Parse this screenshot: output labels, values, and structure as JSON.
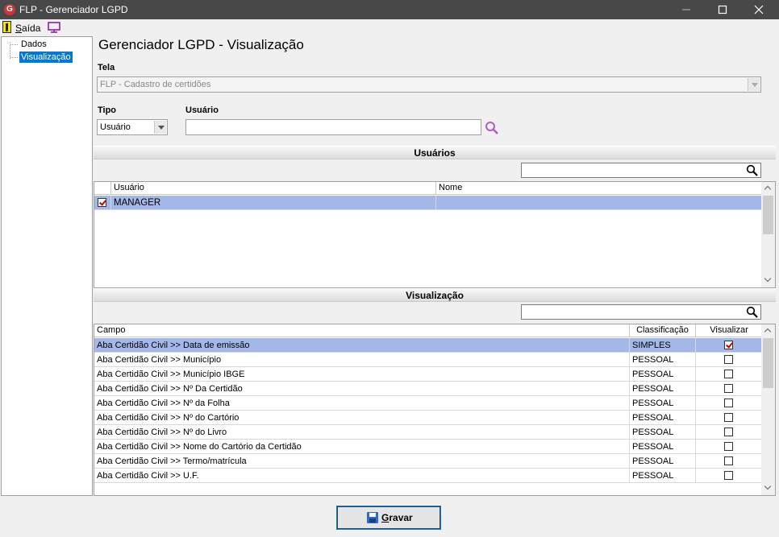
{
  "window": {
    "title": "FLP - Gerenciador LGPD",
    "app_icon_letter": "G",
    "minimize_glyph": "—",
    "maximize_glyph": "□",
    "close_glyph": "✕"
  },
  "menu": {
    "exit_label_first": "S",
    "exit_label_rest": "aída",
    "exit_icon": "exit-door-icon",
    "monitor_icon": "monitor-icon"
  },
  "tree": {
    "items": [
      {
        "label": "Dados",
        "selected": false
      },
      {
        "label": "Visualização",
        "selected": true
      }
    ]
  },
  "form": {
    "page_title": "Gerenciador LGPD - Visualização",
    "screen_label": "Tela",
    "screen_value": "FLP - Cadastro de certidões",
    "type_label": "Tipo",
    "type_value": "Usuário",
    "user_label": "Usuário",
    "user_value": ""
  },
  "users_section": {
    "title": "Usuários",
    "search_value": "",
    "columns": [
      "Usuário",
      "Nome"
    ],
    "rows": [
      {
        "checked": true,
        "usuario": "MANAGER",
        "nome": ""
      }
    ]
  },
  "view_section": {
    "title": "Visualização",
    "search_value": "",
    "columns": [
      "Campo",
      "Classificação",
      "Visualizar"
    ],
    "rows": [
      {
        "campo": "Aba Certidão Civil >> Data de emissão",
        "classificacao": "SIMPLES",
        "visualizar": true
      },
      {
        "campo": "Aba Certidão Civil >> Município",
        "classificacao": "PESSOAL",
        "visualizar": false
      },
      {
        "campo": "Aba Certidão Civil >> Município IBGE",
        "classificacao": "PESSOAL",
        "visualizar": false
      },
      {
        "campo": "Aba Certidão Civil >> Nº Da Certidão",
        "classificacao": "PESSOAL",
        "visualizar": false
      },
      {
        "campo": "Aba Certidão Civil >> Nº da Folha",
        "classificacao": "PESSOAL",
        "visualizar": false
      },
      {
        "campo": "Aba Certidão Civil >> Nº do Cartório",
        "classificacao": "PESSOAL",
        "visualizar": false
      },
      {
        "campo": "Aba Certidão Civil >> Nº do Livro",
        "classificacao": "PESSOAL",
        "visualizar": false
      },
      {
        "campo": "Aba Certidão Civil >> Nome do Cartório da Certidão",
        "classificacao": "PESSOAL",
        "visualizar": false
      },
      {
        "campo": "Aba Certidão Civil >> Termo/matrícula",
        "classificacao": "PESSOAL",
        "visualizar": false
      },
      {
        "campo": "Aba Certidão Civil >> U.F.",
        "classificacao": "PESSOAL",
        "visualizar": false
      }
    ]
  },
  "footer": {
    "save_label_first": "G",
    "save_label_rest": "ravar",
    "save_icon": "floppy-disk-icon"
  },
  "colors": {
    "titlebar": "#484848",
    "selection": "#a3b7e8",
    "tree_selection": "#0078d7",
    "search_accent": "#b05cc8"
  }
}
